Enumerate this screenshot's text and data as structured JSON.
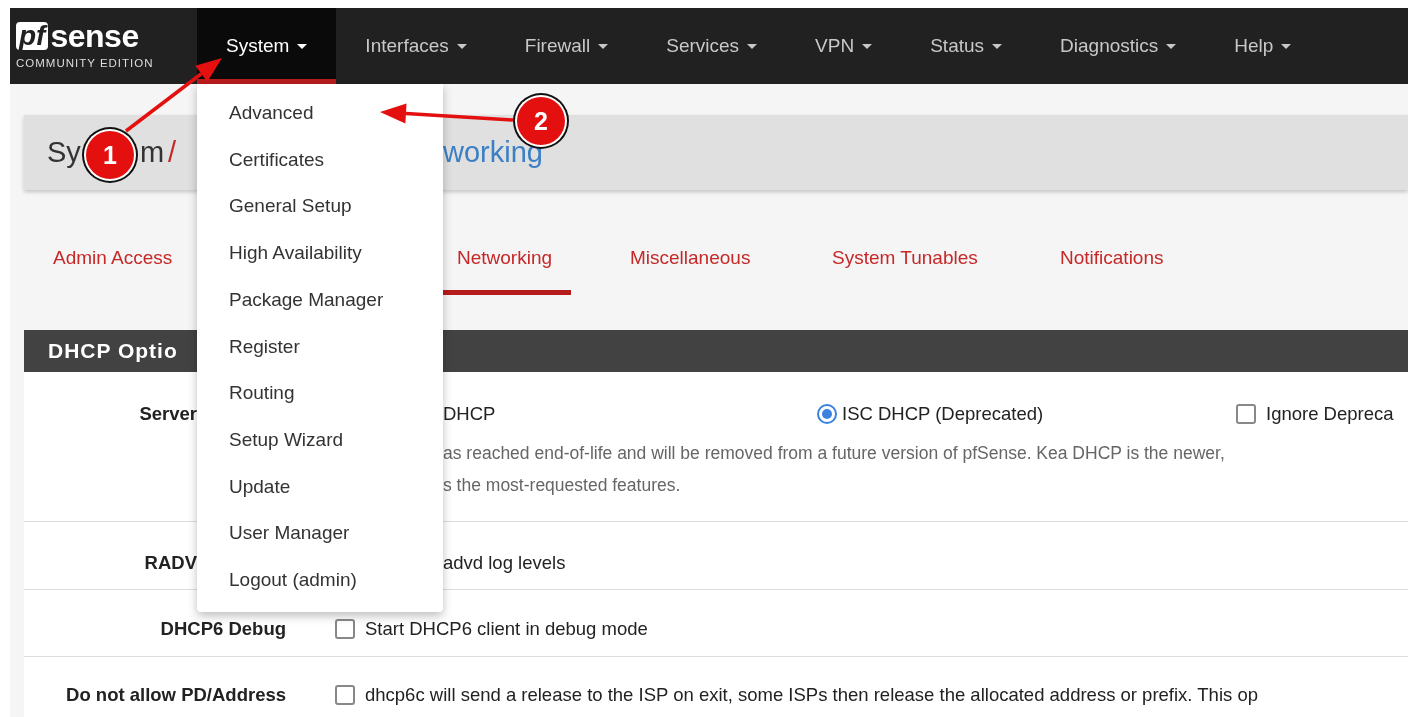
{
  "logo": {
    "mark": "pf",
    "name": "sense",
    "edition": "COMMUNITY EDITION"
  },
  "nav": [
    {
      "label": "System",
      "selected": true
    },
    {
      "label": "Interfaces",
      "selected": false
    },
    {
      "label": "Firewall",
      "selected": false
    },
    {
      "label": "Services",
      "selected": false
    },
    {
      "label": "VPN",
      "selected": false
    },
    {
      "label": "Status",
      "selected": false
    },
    {
      "label": "Diagnostics",
      "selected": false
    },
    {
      "label": "Help",
      "selected": false
    }
  ],
  "dropdown": [
    "Advanced",
    "Certificates",
    "General Setup",
    "High Availability",
    "Package Manager",
    "Register",
    "Routing",
    "Setup Wizard",
    "Update",
    "User Manager",
    "Logout (admin)"
  ],
  "breadcrumb": [
    {
      "text": "Sy",
      "kind": "text"
    },
    {
      "text": "m",
      "kind": "text"
    },
    {
      "text": "/",
      "kind": "separator"
    },
    {
      "text": "working",
      "kind": "link"
    }
  ],
  "tabs": [
    {
      "label": "Admin Access",
      "selected": false
    },
    {
      "label": "Networking",
      "selected": true
    },
    {
      "label": "Miscellaneous",
      "selected": false
    },
    {
      "label": "System Tunables",
      "selected": false
    },
    {
      "label": "Notifications",
      "selected": false
    }
  ],
  "panel": {
    "title": "DHCP Optio",
    "rows": [
      {
        "kind": "backend",
        "label": "Server",
        "fragment": "DHCP",
        "option": {
          "label": "ISC DHCP (Deprecated)",
          "selected": true
        },
        "checkbox": {
          "label": "Ignore Depreca",
          "checked": false
        },
        "help": [
          "as reached end-of-life and will be removed from a future version of pfSense. Kea DHCP is the newer,",
          "s the most-requested features."
        ]
      },
      {
        "kind": "text",
        "label": "RADV",
        "text": "advd log levels"
      },
      {
        "kind": "checkbox",
        "label": "DHCP6 Debug",
        "checkbox": {
          "label": "Start DHCP6 client in debug mode",
          "checked": false
        }
      },
      {
        "kind": "checkbox",
        "label": "Do not allow PD/Address",
        "checkbox": {
          "label": "dhcp6c will send a release to the ISP on exit, some ISPs then release the allocated address or prefix. This op",
          "checked": false
        }
      }
    ]
  },
  "annotations": [
    {
      "number": "1"
    },
    {
      "number": "2"
    }
  ]
}
